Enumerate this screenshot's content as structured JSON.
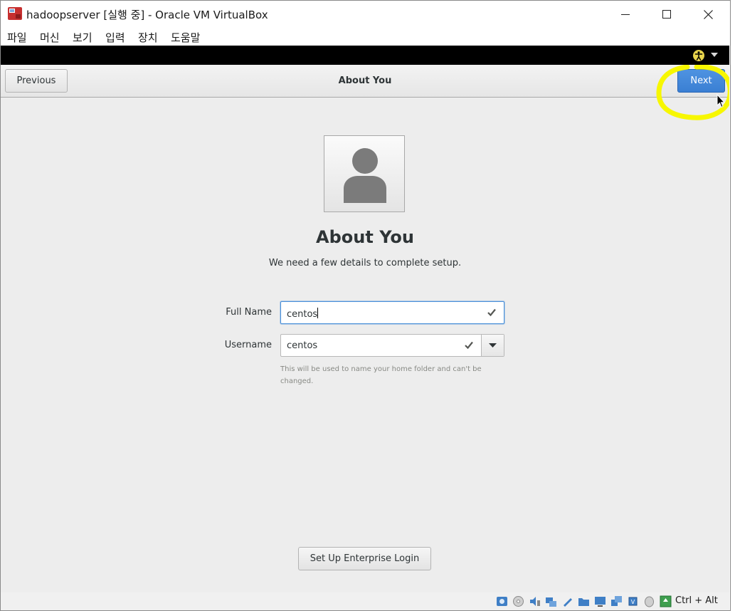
{
  "window": {
    "title": "hadoopserver [실행 중] - Oracle VM VirtualBox"
  },
  "menubar": {
    "items": [
      "파일",
      "머신",
      "보기",
      "입력",
      "장치",
      "도움말"
    ]
  },
  "guest_header": {
    "previous_label": "Previous",
    "title": "About You",
    "next_label": "Next"
  },
  "page": {
    "heading": "About You",
    "subheading": "We need a few details to complete setup.",
    "full_name_label": "Full Name",
    "full_name_value": "centos",
    "username_label": "Username",
    "username_value": "centos",
    "hint": "This will be used to name your home folder and can't be changed.",
    "enterprise_label": "Set Up Enterprise Login"
  },
  "statusbar": {
    "host_key": "Ctrl + Alt"
  },
  "colors": {
    "next_button": "#3a7fd3",
    "highlight": "#f7f700",
    "guest_bg": "#ededed"
  }
}
